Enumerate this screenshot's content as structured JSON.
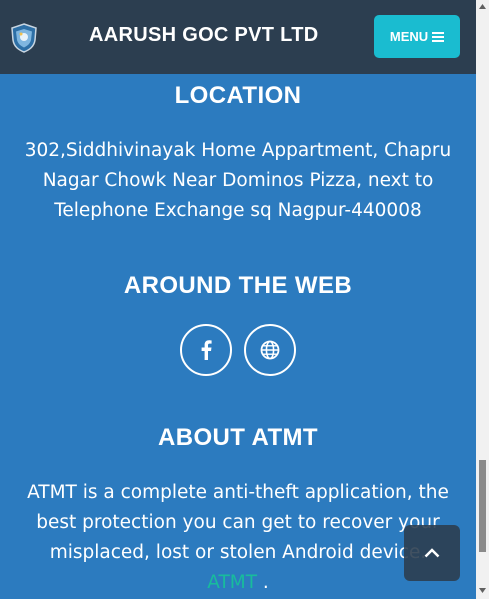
{
  "navbar": {
    "brand": "AARUSH GOC PVT LTD",
    "menu_label": "MENU",
    "menu_icon": "hamburger-icon",
    "logo_icon": "shield-logo-icon"
  },
  "location": {
    "title": "LOCATION",
    "address": "302,Siddhivinayak Home Appartment, Chapru Nagar Chowk Near Dominos Pizza, next to Telephone Exchange sq Nagpur-440008"
  },
  "around_web": {
    "title": "AROUND THE WEB",
    "links": [
      {
        "icon": "facebook-icon"
      },
      {
        "icon": "globe-icon"
      }
    ]
  },
  "about": {
    "title": "ABOUT ATMT",
    "text": "ATMT is a complete anti-theft application, the best protection you can get to recover your misplaced, lost or stolen Android device.",
    "link_text": "ATMT",
    "link_suffix": " ."
  },
  "colors": {
    "background": "#2c7bbf",
    "navbar": "#2c3e50",
    "menu_button": "#1abcd0",
    "link": "#18bc9c"
  }
}
